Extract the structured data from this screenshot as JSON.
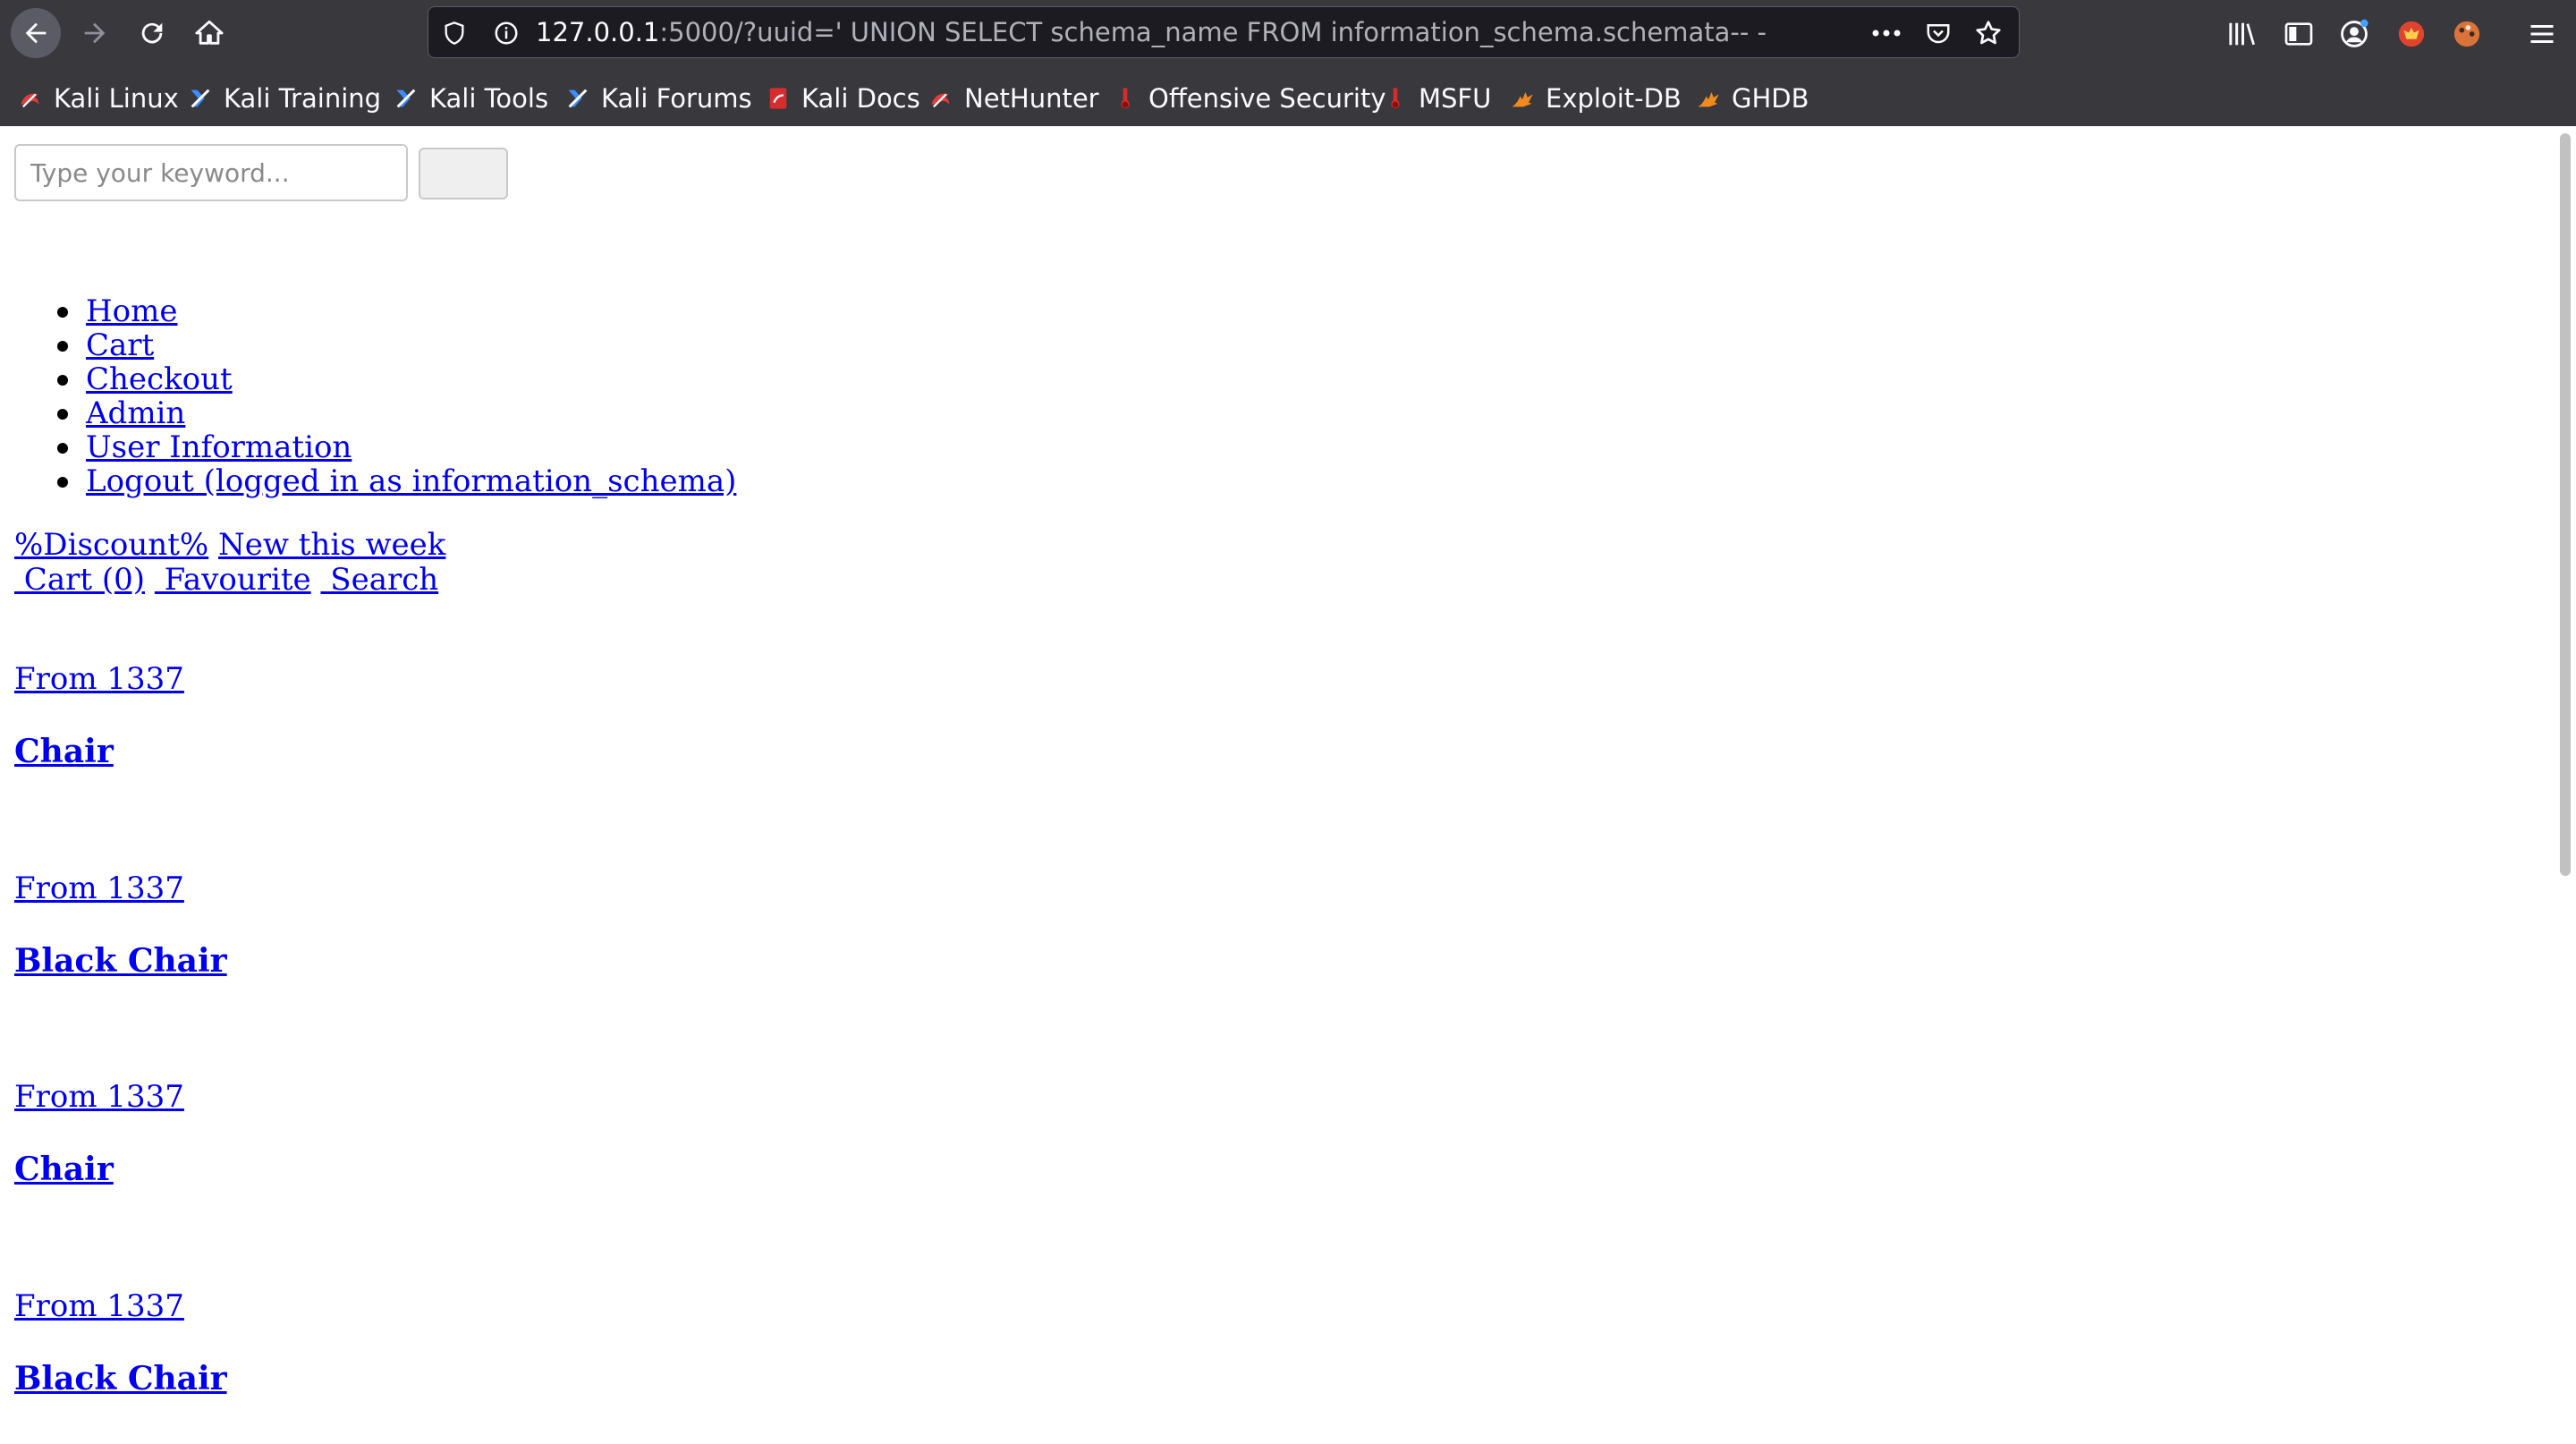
{
  "browser": {
    "url_host": "127.0.0.1",
    "url_rest": ":5000/?uuid=' UNION SELECT schema_name FROM information_schema.schemata-- -",
    "nav_icons": [
      "back-arrow-icon",
      "forward-arrow-icon",
      "reload-icon",
      "home-icon"
    ],
    "bookmarks": [
      {
        "label": "Kali Linux",
        "icon": "kali-dragon-icon"
      },
      {
        "label": "Kali Training",
        "icon": "kali-training-icon"
      },
      {
        "label": "Kali Tools",
        "icon": "kali-tools-icon"
      },
      {
        "label": "Kali Forums",
        "icon": "kali-forums-icon"
      },
      {
        "label": "Kali Docs",
        "icon": "kali-docs-icon"
      },
      {
        "label": "NetHunter",
        "icon": "nethunter-icon"
      },
      {
        "label": "Offensive Security",
        "icon": "offsec-icon"
      },
      {
        "label": "MSFU",
        "icon": "msfu-icon"
      },
      {
        "label": "Exploit-DB",
        "icon": "exploit-db-icon"
      },
      {
        "label": "GHDB",
        "icon": "ghdb-icon"
      }
    ],
    "colors": {
      "chrome": "#38383d",
      "urlbar": "#1c1b22",
      "text": "#fbfbfe"
    }
  },
  "page": {
    "search": {
      "placeholder": "Type your keyword...",
      "button_label": ""
    },
    "nav": [
      "Home",
      "Cart",
      "Checkout",
      "Admin",
      "User Information",
      "Logout (logged in as information_schema)"
    ],
    "promo": {
      "discount": "%Discount%",
      "new_week": "New this week"
    },
    "actions": {
      "cart": " Cart (0)",
      "favourite": " Favourite",
      "search": " Search"
    },
    "products": [
      {
        "price": "From 1337",
        "name": "Chair"
      },
      {
        "price": "From 1337",
        "name": "Black Chair"
      },
      {
        "price": "From 1337",
        "name": "Chair"
      },
      {
        "price": "From 1337",
        "name": "Black Chair"
      }
    ],
    "link_color": "#0000ee"
  }
}
